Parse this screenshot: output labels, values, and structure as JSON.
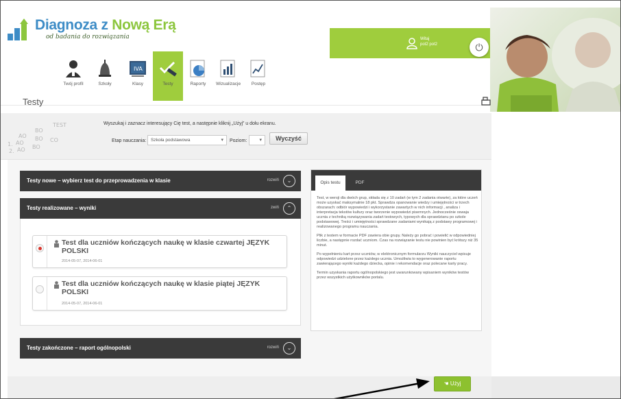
{
  "brand": {
    "title_main": "Diagnoza z ",
    "title_accent": "Nową Erą",
    "subtitle": "od badania do rozwiązania",
    "colors": {
      "blue": "#3d8cc6",
      "green": "#9fcd3d",
      "dark": "#3a3a3a"
    }
  },
  "user": {
    "line1": "Witaj",
    "line2": "pot2 pot2"
  },
  "nav": [
    {
      "label": "Twój profil",
      "icon": "user-icon",
      "active": false
    },
    {
      "label": "Szkoły",
      "icon": "bell-icon",
      "active": false
    },
    {
      "label": "Klasy",
      "icon": "board-icon",
      "active": false
    },
    {
      "label": "Testy",
      "icon": "pencil-icon",
      "active": true
    },
    {
      "label": "Raporty",
      "icon": "pie-chart-icon",
      "active": false
    },
    {
      "label": "Wizualizacje",
      "icon": "bar-chart-icon",
      "active": false
    },
    {
      "label": "Postęp",
      "icon": "line-chart-icon",
      "active": false
    }
  ],
  "page": {
    "title": "Testy"
  },
  "search": {
    "instruction": "Wyszukaj i zaznacz interesujący Cię test, a następnie kliknij „Użyj” u dołu ekranu.",
    "etap_label": "Etap nauczania:",
    "etap_value": "Szkoła podstawowa",
    "poziom_label": "Poziom:",
    "poziom_value": "",
    "clear_label": "Wyczyść"
  },
  "sections": {
    "new": {
      "title": "Testy nowe – wybierz test do przeprowadzenia w klasie",
      "toggle": "rozwiń"
    },
    "ongoing": {
      "title": "Testy realizowane – wyniki",
      "toggle": "zwiń"
    },
    "finished": {
      "title": "Testy zakończone – raport ogólnopolski",
      "toggle": "rozwiń"
    }
  },
  "tests": [
    {
      "title": "Test dla uczniów kończących naukę w klasie czwartej JĘZYK POLSKI",
      "dates": "2014-05-07, 2014-06-01",
      "selected": true
    },
    {
      "title": "Test dla uczniów kończących naukę w klasie piątej JĘZYK POLSKI",
      "dates": "2014-05-07, 2014-06-01",
      "selected": false
    }
  ],
  "panel": {
    "tab_opis": "Opis testu",
    "tab_pdf": "PDF",
    "p1": "Test, w wersji dla dwóch grup, składa się z 10 zadań (w tym 2 zadania otwarte), za które uczeń może uzyskać maksymalnie 18 pkt. Sprawdza opanowanie wiedzy i umiejętności w trzech obszarach: odbiór wypowiedzi i wykorzystanie zawartych w nich informacji , analiza i interpretacja tekstów kultury oraz tworzenie wypowiedzi pisemnych. Jednocześnie oswaja ucznia z techniką rozwiązywania zadań testowych, typowych dla sprawdzianu po szkole podstawowej. Treści i umiejętności sprawdzane zadaniami wynikają z podstawy programowej i realizowanego programu nauczania.",
    "p2": "Plik z testem w formacie PDF zawiera obie grupy. Należy go pobrać i powielić w odpowiedniej liczbie, a następnie rozdać uczniom. Czas na rozwiązanie testu nie powinien być krótszy niż 35 minut.",
    "p3": "Po wypełnieniu kart przez uczniów, w elektronicznym formularzu Wyniki nauczyciel wpisuje odpowiedzi udzielone przez każdego ucznia. Umożliwia to wygenerowanie raportu zawierającego wyniki każdego dziecka, opinie i rekomendacje oraz polecane karty pracy.",
    "p4": "Termin uzyskania raportu ogólnopolskiego jest uwarunkowany wpisaniem wyników testów przez wszystkich użytkowników portalu."
  },
  "actions": {
    "use_label": "Użyj"
  }
}
